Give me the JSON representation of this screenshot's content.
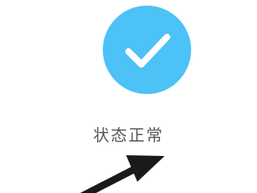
{
  "status": {
    "icon": "check-icon",
    "label": "状态正常",
    "color": "#4cc2f7"
  },
  "annotation": {
    "icon": "arrow-icon",
    "color": "#1a1a1a"
  }
}
